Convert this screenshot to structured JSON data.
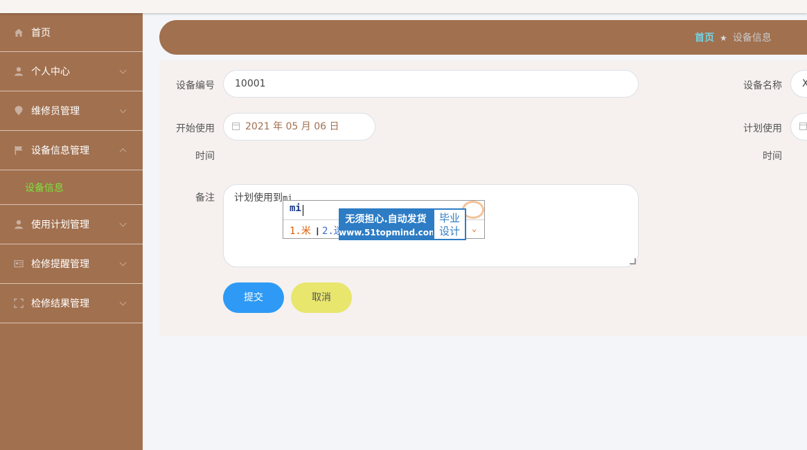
{
  "sidebar": {
    "items": [
      {
        "label": "首页",
        "icon": "home-icon"
      },
      {
        "label": "个人中心",
        "icon": "user-icon"
      },
      {
        "label": "维修员管理",
        "icon": "location-icon"
      },
      {
        "label": "设备信息管理",
        "icon": "flag-icon"
      },
      {
        "label": "使用计划管理",
        "icon": "user-icon"
      },
      {
        "label": "检修提醒管理",
        "icon": "card-icon"
      },
      {
        "label": "检修结果管理",
        "icon": "frame-icon"
      }
    ],
    "submenu": {
      "label": "设备信息"
    }
  },
  "breadcrumb": {
    "home": "首页",
    "separator": "★",
    "current": "设备信息"
  },
  "form": {
    "device_no": {
      "label": "设备编号",
      "value": "10001"
    },
    "device_name": {
      "label": "设备名称",
      "value": "X"
    },
    "start_date": {
      "label_line1": "开始使用",
      "label_line2": "时间",
      "value": "2021 年 05 月 06 日"
    },
    "plan_date": {
      "label_line1": "计划使用",
      "label_line2": "时间"
    },
    "remark": {
      "label": "备注",
      "value": "计划使用到",
      "composing": "mi"
    },
    "submit_label": "提交",
    "cancel_label": "取消"
  },
  "ime": {
    "composition": "mi",
    "candidate1": "1.米",
    "candidate2": "2.迷",
    "ad_line1": "无须担心.自动发货",
    "ad_line2": "www.51topmind.com",
    "ad_side_line1": "毕业",
    "ad_side_line2": "设计"
  },
  "colors": {
    "sidebar": "#a1704f",
    "accent_green": "#7ee03c",
    "submit": "#2e9af5",
    "cancel": "#e8e66d"
  }
}
